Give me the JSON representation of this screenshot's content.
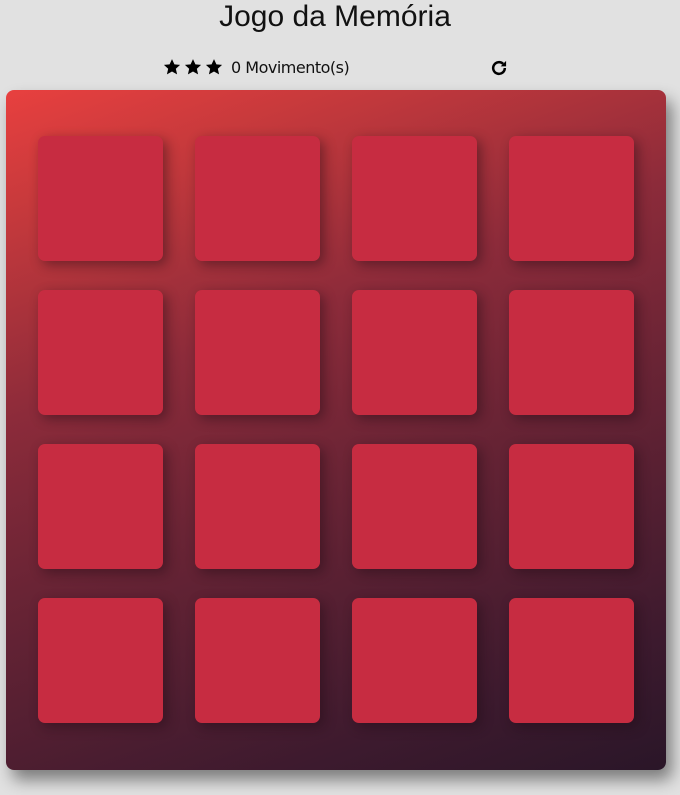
{
  "title": "Jogo da Memória",
  "score_panel": {
    "stars": [
      {
        "icon": "star-icon"
      },
      {
        "icon": "star-icon"
      },
      {
        "icon": "star-icon"
      }
    ],
    "moves_count": "0",
    "moves_label": "Movimento(s)",
    "restart_icon": "refresh-icon"
  },
  "deck": {
    "card_color": "#c72c41",
    "rows": 4,
    "columns": 4,
    "cards_face_down": 16
  },
  "colors": {
    "background": "#e1e1e1",
    "card": "#c72c41",
    "deck_gradient_start": "#e8403f",
    "deck_gradient_end": "#2a1628"
  }
}
